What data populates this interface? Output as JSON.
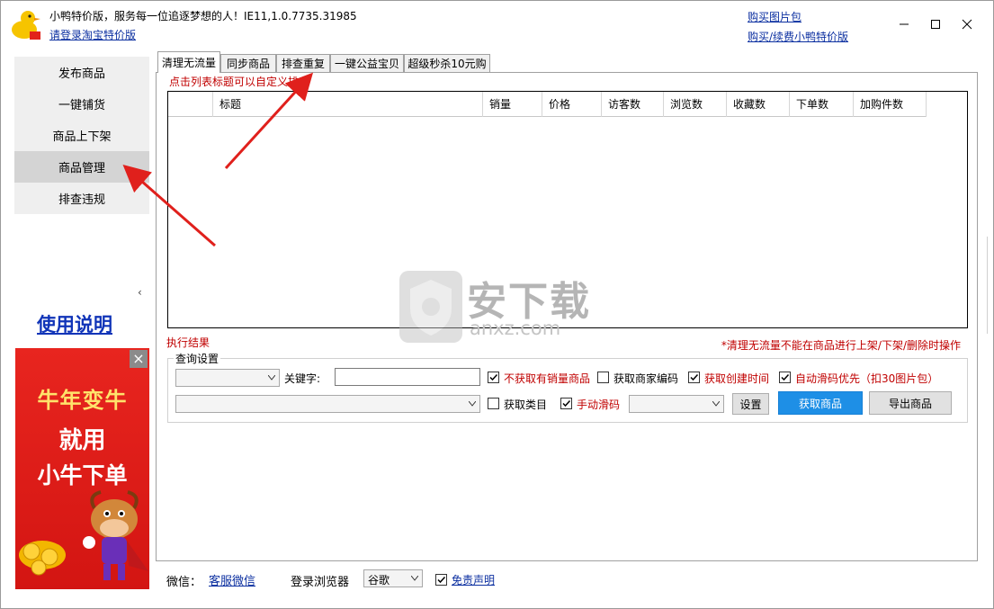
{
  "app": {
    "title": "小鸭特价版，服务每一位追逐梦想的人！IE11,1.0.7735.31985",
    "login_link": "请登录淘宝特价版",
    "buy_pic_link": "购买图片包",
    "buy_renew_link": "购买/续费小鸭特价版"
  },
  "sidebar": {
    "items": [
      {
        "label": "发布商品"
      },
      {
        "label": "一键铺货"
      },
      {
        "label": "商品上下架"
      },
      {
        "label": "商品管理"
      },
      {
        "label": "排查违规"
      }
    ],
    "collapse": "‹",
    "usage_link": "使用说明"
  },
  "ad": {
    "close": "×",
    "line1": "牛年变牛",
    "line2": "就用",
    "line3": "小牛下单"
  },
  "tabs": [
    {
      "label": "清理无流量"
    },
    {
      "label": "同步商品"
    },
    {
      "label": "排查重复"
    },
    {
      "label": "一键公益宝贝"
    },
    {
      "label": "超级秒杀10元购"
    }
  ],
  "hint": "点击列表标题可以自定义排序",
  "grid": {
    "columns": [
      "",
      "标题",
      "销量",
      "价格",
      "访客数",
      "浏览数",
      "收藏数",
      "下单数",
      "加购件数"
    ],
    "rows": []
  },
  "exec_result": "执行结果",
  "exec_note": "*清理无流量不能在商品进行上架/下架/删除时操作",
  "query": {
    "legend": "查询设置",
    "keyword_label": "关键字:",
    "keyword_value": "",
    "cb_no_sales": "不获取有销量商品",
    "cb_merchant_code": "获取商家编码",
    "cb_create_time": "获取创建时间",
    "cb_auto_slide": "自动滑码优先（扣30图片包）",
    "cb_category": "获取类目",
    "cb_manual_slide": "手动滑码",
    "settings_btn": "设置",
    "fetch_btn": "获取商品",
    "export_btn": "导出商品"
  },
  "footer": {
    "wechat_label": "微信：",
    "wechat_link": "客服微信",
    "browser_label": "登录浏览器",
    "browser_value": "谷歌",
    "disclaimer": "免责声明"
  },
  "watermark": {
    "main": "安下载",
    "sub": "anxz.com"
  },
  "colors": {
    "accent_blue": "#1e8fe6",
    "link": "#0b2fa0",
    "warning_red": "#c00000",
    "ad_red": "#e8251f"
  }
}
